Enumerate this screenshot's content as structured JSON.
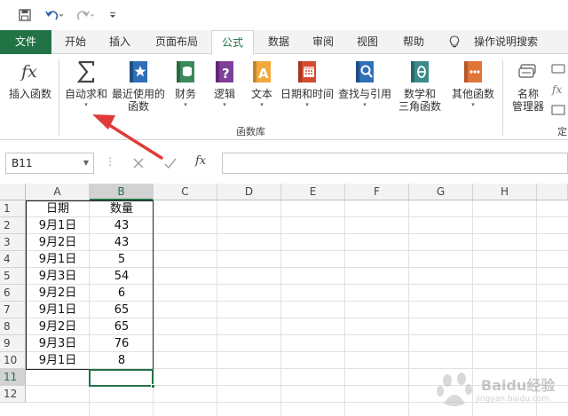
{
  "quick_access": {
    "save_icon": "save-icon",
    "undo_icon": "undo-icon",
    "redo_icon": "redo-icon",
    "customize_icon": "customize-icon"
  },
  "tabs": [
    {
      "label": "文件"
    },
    {
      "label": "开始"
    },
    {
      "label": "插入"
    },
    {
      "label": "页面布局"
    },
    {
      "label": "公式"
    },
    {
      "label": "数据"
    },
    {
      "label": "审阅"
    },
    {
      "label": "视图"
    },
    {
      "label": "帮助"
    },
    {
      "label": "操作说明搜索"
    }
  ],
  "ribbon": {
    "insert_function": "插入函数",
    "autosum_l1": "自动求和",
    "recent_l1": "最近使用的",
    "recent_l2": "函数",
    "financial": "财务",
    "logical": "逻辑",
    "text": "文本",
    "datetime": "日期和时间",
    "lookup": "查找与引用",
    "math_l1": "数学和",
    "math_l2": "三角函数",
    "more": "其他函数",
    "name_mgr_l1": "名称",
    "name_mgr_l2": "管理器",
    "group_label": "函数库",
    "group_label_2": "定"
  },
  "formula_bar": {
    "name_box": "B11",
    "cancel_icon": "cancel-icon",
    "enter_icon": "enter-icon",
    "fx": "fx",
    "value": ""
  },
  "columns": [
    "A",
    "B",
    "C",
    "D",
    "E",
    "F",
    "G",
    "H"
  ],
  "rows": [
    "1",
    "2",
    "3",
    "4",
    "5",
    "6",
    "7",
    "8",
    "9",
    "10",
    "11",
    "12"
  ],
  "table": {
    "headers": [
      "日期",
      "数量"
    ],
    "rows": [
      [
        "9月1日",
        "43"
      ],
      [
        "9月2日",
        "43"
      ],
      [
        "9月1日",
        "5"
      ],
      [
        "9月3日",
        "54"
      ],
      [
        "9月2日",
        "6"
      ],
      [
        "9月1日",
        "65"
      ],
      [
        "9月2日",
        "65"
      ],
      [
        "9月3日",
        "76"
      ],
      [
        "9月1日",
        "8"
      ]
    ]
  },
  "watermark": {
    "brand": "Baidu经验",
    "url": "jingyan.baidu.com"
  },
  "colors": {
    "accent": "#217346",
    "annotation": "#e03a3a"
  }
}
